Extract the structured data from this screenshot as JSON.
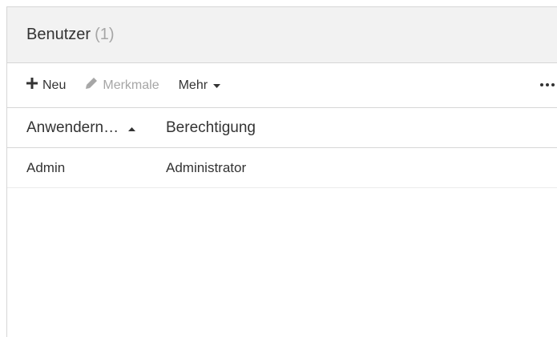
{
  "panel": {
    "title": "Benutzer",
    "count": "(1)"
  },
  "toolbar": {
    "new_label": "Neu",
    "new_icon": "plus-icon",
    "properties_label": "Merkmale",
    "properties_icon": "pencil-icon",
    "more_label": "Mehr",
    "overflow_icon": "ellipsis-icon"
  },
  "grid": {
    "columns": [
      {
        "label": "Anwendern…",
        "sort": "ascending"
      },
      {
        "label": "Berechtigung"
      }
    ],
    "rows": [
      {
        "username": "Admin",
        "permission": "Administrator"
      }
    ]
  },
  "colors": {
    "header_bg": "#f2f2f2",
    "border": "#d6d6d6",
    "text": "#333333",
    "muted": "#a6a6a6"
  }
}
